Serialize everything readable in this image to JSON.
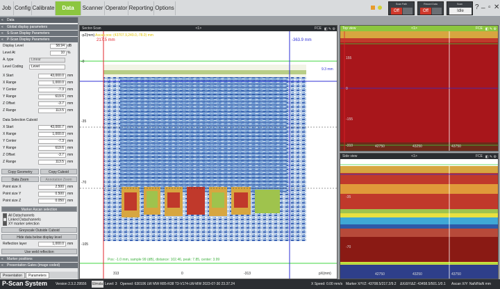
{
  "menu": {
    "items": [
      "Job",
      "Config",
      "Calibrate",
      "Data View",
      "Scanner",
      "Operator",
      "Reporting",
      "Options"
    ],
    "active": "Data View"
  },
  "indicators": [
    {
      "label": "Scan Path",
      "value": "Off"
    },
    {
      "label": "Record Data",
      "value": "Off"
    },
    {
      "label": "Scan",
      "value": "Idle"
    }
  ],
  "window_controls": {
    "help": "?",
    "minimize": "_",
    "restore": "▫",
    "close": "✕"
  },
  "left_panel": {
    "title": "Data",
    "sections": [
      "Global display parameters",
      "S-Scan Display Parameters",
      "P-Scan Display Parameters"
    ],
    "display_level": {
      "label": "Display Level",
      "value": "58.94",
      "unit": "dB"
    },
    "level_at": {
      "label": "Level At",
      "value": "10",
      "unit": "%"
    },
    "a_type": {
      "label": "A. type",
      "value": "Linear"
    },
    "level_coding": {
      "label": "Level Coding",
      "value": "Level"
    },
    "params": [
      {
        "label": "X Start",
        "value": "43,000.0",
        "unit": "mm"
      },
      {
        "label": "X Range",
        "value": "1,000.0",
        "unit": "mm"
      },
      {
        "label": "Y Center",
        "value": "-7.3",
        "unit": "mm"
      },
      {
        "label": "Y Range",
        "value": "619.6",
        "unit": "mm"
      },
      {
        "label": "Z Offset",
        "value": "-3.7",
        "unit": "mm"
      },
      {
        "label": "Z Range",
        "value": "113.5",
        "unit": "mm"
      }
    ],
    "cuboid_title": "Data Selection Cuboid",
    "cuboid": [
      {
        "label": "X Start",
        "value": "43,000.7",
        "unit": "mm"
      },
      {
        "label": "X Range",
        "value": "1,000.0",
        "unit": "mm"
      },
      {
        "label": "Y Center",
        "value": "-7.3",
        "unit": "mm"
      },
      {
        "label": "Y Range",
        "value": "619.6",
        "unit": "mm"
      },
      {
        "label": "Z Offset",
        "value": "-3.7",
        "unit": "mm"
      },
      {
        "label": "Z Range",
        "value": "113.5",
        "unit": "mm"
      }
    ],
    "copy_geometry": "Copy Geometry",
    "copy_cuboid": "Copy Cuboid",
    "data_zoom": "Data Zoom",
    "annotation_zoom": "Annotation Zoom",
    "point_size": [
      {
        "label": "Point size X",
        "value": "2.500",
        "unit": "mm"
      },
      {
        "label": "Point size Y",
        "value": "0.500",
        "unit": "mm"
      },
      {
        "label": "Point size Z",
        "value": "0.050",
        "unit": "mm"
      }
    ],
    "marker_ascan": "Marker Ascan selection",
    "checks": [
      {
        "label": "All Datachannels",
        "on": true
      },
      {
        "label": "Linked Datachannels",
        "on": false
      },
      {
        "label": "XY marker selection",
        "on": true
      }
    ],
    "greyscale": "Greyscale Outside Cuboid",
    "hide_data": "Hide data below display level",
    "reflection": {
      "label": "Reflection layer",
      "value": "1,000.0",
      "unit": "mm"
    },
    "weld_reflection": "Use weld reflection",
    "marker_positions": "Marker positions",
    "presentation_gates": "Presentation Gates (image coded)",
    "tabs": [
      "Presentation",
      "Parameters"
    ]
  },
  "sector_view": {
    "title": "Sector-Scan",
    "index": "<1>",
    "fce": "FCE",
    "axis_label": "-pZ(mm)",
    "ascan_pos": "Ascan pos: (43707.9,249.0,-78.0) mm",
    "marker_red": "217.5 mm",
    "marker_blue": "-363.9 mm",
    "marker_right": "9.3 mm",
    "y_ticks": [
      "-0",
      "-35",
      "-70",
      "-105"
    ],
    "x_ticks": [
      "313",
      "0",
      "-313"
    ],
    "x_axis_label": "pX(mm)",
    "footer": "Pos: -1.0 mm, sample 99 (dB), distance: 102.46, peak: 7.85, center: 3.99"
  },
  "top_view": {
    "title": "Top view",
    "index": "<1>",
    "fce": "FCE",
    "y_ticks": [
      "155",
      "0",
      "-155",
      "-310"
    ],
    "x_ticks": [
      "42750",
      "43250",
      "43750"
    ]
  },
  "side_view": {
    "title": "Side view",
    "index": "<1>",
    "fce": "FCE",
    "y_ticks": [
      "-35",
      "-70"
    ],
    "x_ticks": [
      "42750",
      "43250",
      "43750"
    ]
  },
  "status": {
    "app_name": "P-Scan System",
    "version": "Version 2.3.2.29556",
    "level_badge": "Elmsla",
    "level": "Level: 3",
    "opened": "Opened: 630106 LW MW R85-R38 T3-V174-LW-MW 2023-07-30 23.37.24",
    "speed": "X Speed: 0.00 mm/s",
    "marker": "Marker X/Y/Z: 43708.5/217.2/9.2",
    "delta": "ΔX/ΔY/ΔZ: 43458.5/501.1/0.1",
    "ascan": "Ascan X/Y: NaN/NaN mm"
  },
  "colors": {
    "accent": "#8cc63f",
    "red_marker": "#e0242b",
    "blue_marker": "#2d2fd6",
    "green_marker": "#3fd63f"
  }
}
